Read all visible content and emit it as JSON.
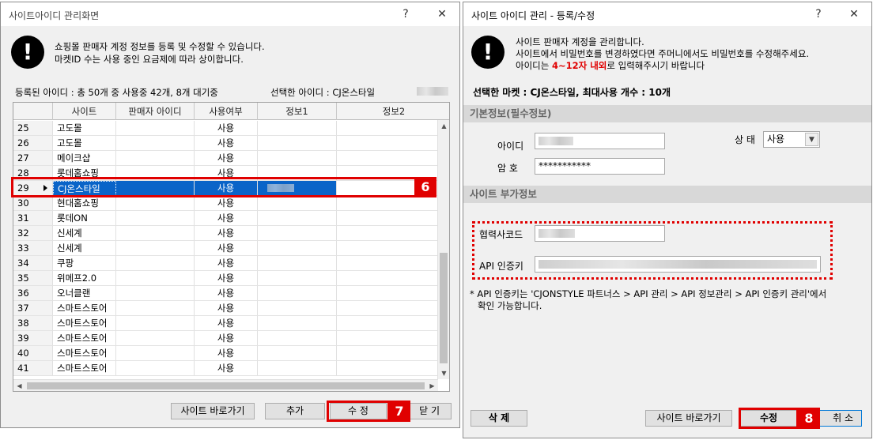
{
  "left_window": {
    "title": "사이트아이디 관리화면",
    "help": "?",
    "close": "✕",
    "info_icon": "!",
    "info_lines": [
      "쇼핑몰 판매자 계정 정보를 등록 및 수정할 수 있습니다.",
      "마켓ID 수는 사용 중인 요금제에 따라 상이합니다."
    ],
    "registered": "등록된 아이디 : 총 50개 중 사용중 42개, 8개 대기중",
    "selected": "선택한 아이디 : CJ온스타일",
    "columns": [
      "사이트",
      "판매자 아이디",
      "사용여부",
      "정보1",
      "정보2"
    ],
    "rows": [
      {
        "num": "25",
        "site": "고도몰",
        "use": "사용"
      },
      {
        "num": "26",
        "site": "고도몰",
        "use": "사용"
      },
      {
        "num": "27",
        "site": "메이크샵",
        "use": "사용"
      },
      {
        "num": "28",
        "site": "롯데홈쇼핑",
        "use": "사용"
      },
      {
        "num": "29",
        "site": "CJ온스타일",
        "use": "사용"
      },
      {
        "num": "30",
        "site": "현대홈쇼핑",
        "use": "사용"
      },
      {
        "num": "31",
        "site": "롯데ON",
        "use": "사용"
      },
      {
        "num": "32",
        "site": "신세계",
        "use": "사용"
      },
      {
        "num": "33",
        "site": "신세계",
        "use": "사용"
      },
      {
        "num": "34",
        "site": "쿠팡",
        "use": "사용"
      },
      {
        "num": "35",
        "site": "위메프2.0",
        "use": "사용"
      },
      {
        "num": "36",
        "site": "오너클랜",
        "use": "사용"
      },
      {
        "num": "37",
        "site": "스마트스토어",
        "use": "사용"
      },
      {
        "num": "38",
        "site": "스마트스토어",
        "use": "사용"
      },
      {
        "num": "39",
        "site": "스마트스토어",
        "use": "사용"
      },
      {
        "num": "40",
        "site": "스마트스토어",
        "use": "사용"
      },
      {
        "num": "41",
        "site": "스마트스토어",
        "use": "사용"
      }
    ],
    "buttons": {
      "site_go": "사이트 바로가기",
      "add": "추가",
      "edit": "수 정",
      "close": "닫 기"
    },
    "badges": {
      "row": "6",
      "edit": "7"
    },
    "arrows": {
      "up": "▲",
      "down": "▼",
      "left": "◀",
      "right": "▶"
    }
  },
  "right_window": {
    "title": "사이트 아이디 관리 - 등록/수정",
    "help": "?",
    "close": "✕",
    "info_icon": "!",
    "info_line1": "사이트 판매자 계정을 관리합니다.",
    "info_line2": "사이트에서 비밀번호를 변경하였다면 주머니에서도 비밀번호를 수정해주세요.",
    "info_line3_pre": "아이디는 ",
    "info_line3_em": "4~12자 내외",
    "info_line3_post": "로 입력해주시기 바랍니다",
    "selected_market": "선택한 마켓 : CJ온스타일, 최대사용 개수 : 10개",
    "section_basic": "기본정보(필수정보)",
    "label_id": "아이디",
    "label_status": "상 태",
    "status_value": "사용",
    "label_pw": "암 호",
    "pw_value": "***********",
    "section_extra": "사이트 부가정보",
    "label_partner": "협력사코드",
    "label_api": "API 인증키",
    "note_line1": "* API 인증키는 'CJONSTYLE 파트너스 > API 관리 > API 정보관리 > API 인증키 관리'에서",
    "note_line2": "확인 가능합니다.",
    "buttons": {
      "delete": "삭 제",
      "site_go": "사이트 바로가기",
      "edit": "수정",
      "cancel": "취 소"
    },
    "badge_edit": "8"
  },
  "colors": {
    "highlight": "#e00000",
    "selection": "#0a64c8",
    "emphasis": "#e00000"
  }
}
